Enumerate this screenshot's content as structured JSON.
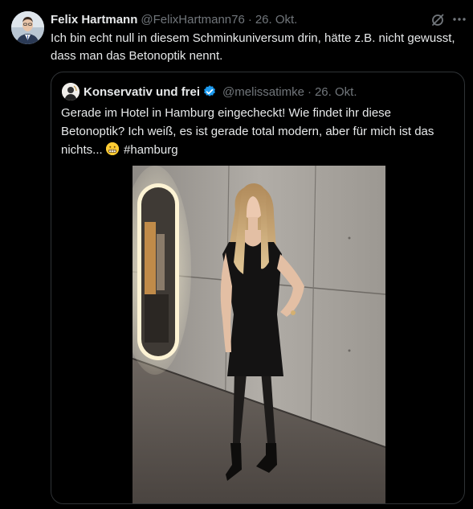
{
  "tweet": {
    "author_name": "Felix Hartmann",
    "author_handle": "@FelixHartmann76",
    "separator": "·",
    "time": "26. Okt.",
    "text": "Ich bin echt null in diesem Schminkuniversum drin, hätte z.B. nicht gewusst, dass man das Betonoptik nennt."
  },
  "quote": {
    "author_name": "Konservativ und frei",
    "author_handle": "@melissatimke",
    "separator": "·",
    "time": "26. Okt.",
    "text": "Gerade im Hotel in Hamburg eingecheckt! Wie findet ihr diese Betonoptik? Ich weiß, es ist gerade total modern, aber für mich ist das nichts...",
    "hashtag": "#hamburg",
    "emoji": "grimacing-face"
  },
  "icons": {
    "grok": "grok-icon",
    "more": "more-icon",
    "verified": "verified-badge-icon"
  },
  "colors": {
    "background": "#000000",
    "text": "#e7e9ea",
    "secondary": "#71767b",
    "border": "#2f3336",
    "verified": "#1d9bf0"
  }
}
